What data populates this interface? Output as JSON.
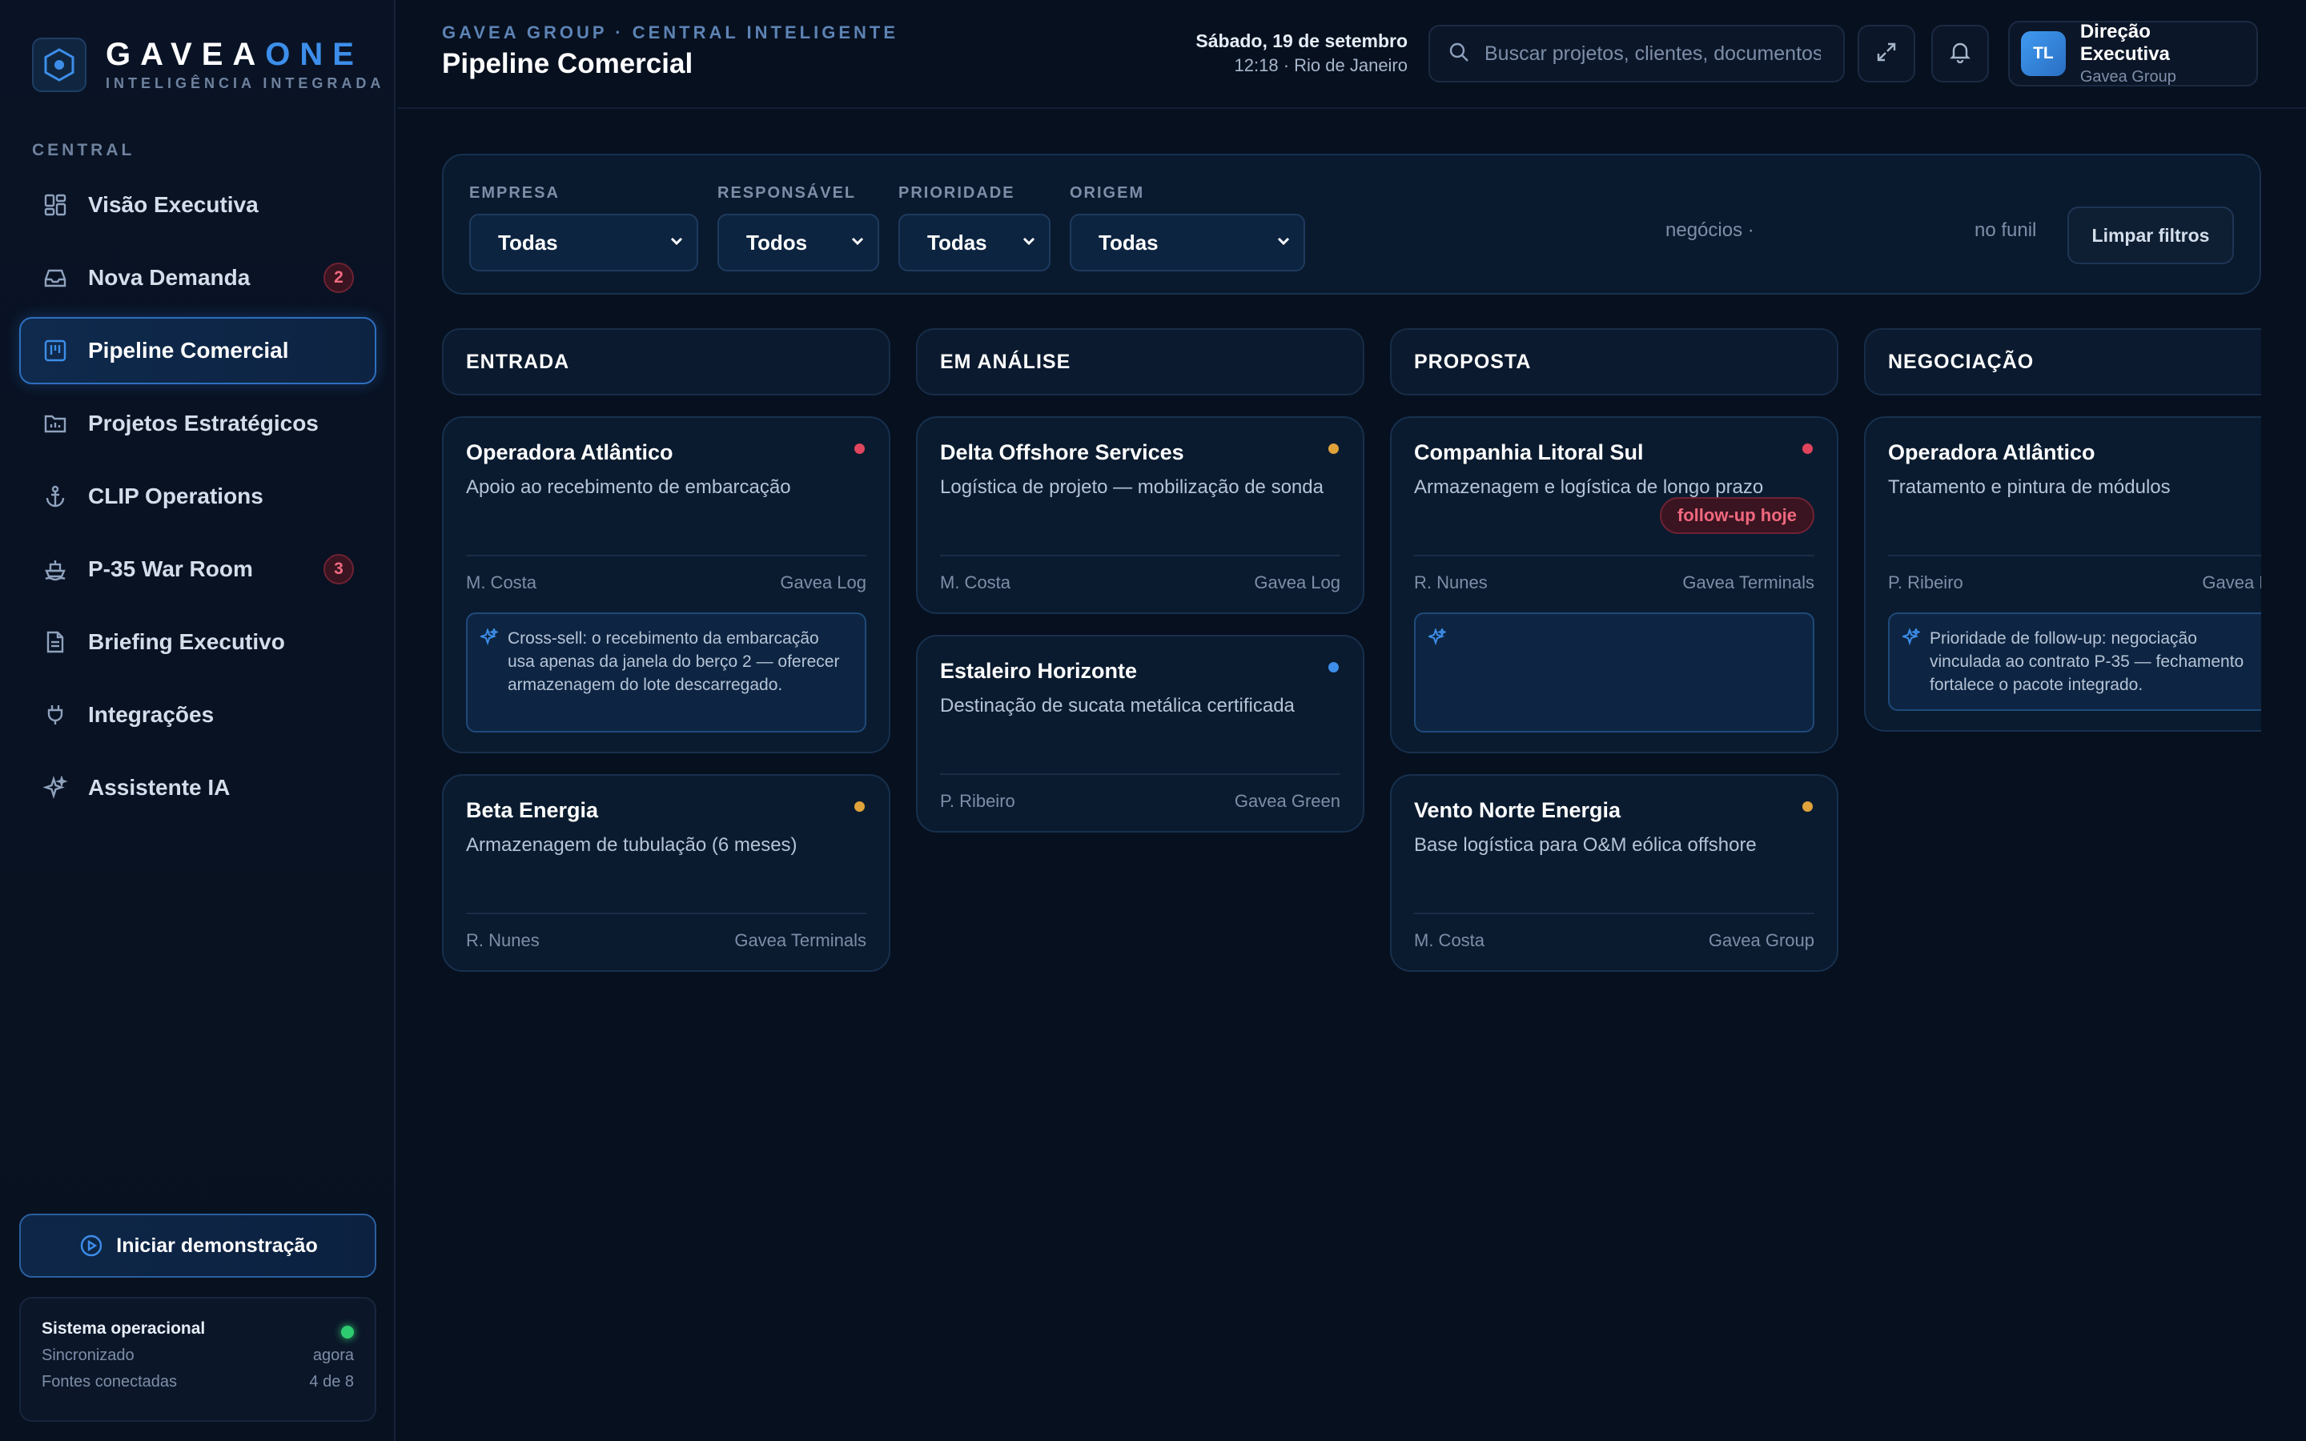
{
  "brand": {
    "name_main": "GAVEA",
    "name_accent": "ONE",
    "subtitle": "INTELIGÊNCIA INTEGRADA"
  },
  "sidebar": {
    "section": "CENTRAL",
    "items": [
      {
        "label": "Visão Executiva",
        "icon": "dashboard-icon"
      },
      {
        "label": "Nova Demanda",
        "icon": "inbox-icon",
        "badge": "2"
      },
      {
        "label": "Pipeline Comercial",
        "icon": "kanban-icon",
        "active": true
      },
      {
        "label": "Projetos Estratégicos",
        "icon": "chart-folder-icon"
      },
      {
        "label": "CLIP Operations",
        "icon": "anchor-icon"
      },
      {
        "label": "P-35 War Room",
        "icon": "ship-icon",
        "badge": "3"
      },
      {
        "label": "Briefing Executivo",
        "icon": "document-icon"
      },
      {
        "label": "Integrações",
        "icon": "plug-icon"
      },
      {
        "label": "Assistente IA",
        "icon": "sparkle-icon"
      }
    ],
    "demo_button": "Iniciar demonstração",
    "status": {
      "title": "Sistema operacional",
      "rows": [
        {
          "label": "Sincronizado",
          "value": "agora"
        },
        {
          "label": "Fontes conectadas",
          "value": "4 de 8"
        }
      ]
    }
  },
  "header": {
    "breadcrumb": "GAVEA GROUP · CENTRAL INTELIGENTE",
    "title": "Pipeline Comercial",
    "date": "Sábado, 19 de setembro",
    "time": "12:18 · Rio de Janeiro",
    "search_placeholder": "Buscar projetos, clientes, documentos",
    "user": {
      "initials": "TL",
      "name": "Direção Executiva",
      "org": "Gavea Group"
    }
  },
  "filters": {
    "items": [
      {
        "label": "EMPRESA",
        "value": "Todas"
      },
      {
        "label": "RESPONSÁVEL",
        "value": "Todos"
      },
      {
        "label": "PRIORIDADE",
        "value": "Todas"
      },
      {
        "label": "ORIGEM",
        "value": "Todas"
      }
    ],
    "count_left": "negócios ·",
    "count_right": "no funil",
    "clear": "Limpar filtros"
  },
  "columns": [
    {
      "title": "ENTRADA"
    },
    {
      "title": "EM ANÁLISE"
    },
    {
      "title": "PROPOSTA"
    },
    {
      "title": "NEGOCIAÇÃO"
    }
  ],
  "cards": {
    "c1": {
      "title": "Operadora Atlântico",
      "desc": "Apoio ao recebimento de embarcação",
      "owner": "M. Costa",
      "company": "Gavea Log",
      "insight": "Cross-sell: o recebimento da embarcação usa apenas da janela do berço 2 — oferecer armazenagem do lote descarregado.",
      "dot": "#e0455e"
    },
    "c2": {
      "title": "Beta Energia",
      "desc": "Armazenagem de tubulação (6 meses)",
      "owner": "R. Nunes",
      "company": "Gavea Terminals",
      "dot": "#e0a23a"
    },
    "c3": {
      "title": "Delta Offshore Services",
      "desc": "Logística de projeto — mobilização de sonda",
      "owner": "M. Costa",
      "company": "Gavea Log",
      "dot": "#e0a23a"
    },
    "c4": {
      "title": "Estaleiro Horizonte",
      "desc": "Destinação de sucata metálica certificada",
      "owner": "P. Ribeiro",
      "company": "Gavea Green",
      "dot": "#3d8eea"
    },
    "c5": {
      "title": "Companhia Litoral Sul",
      "desc": "Armazenagem e logística de longo prazo",
      "tag": "follow-up hoje",
      "owner": "R. Nunes",
      "company": "Gavea Terminals",
      "insight": "",
      "dot": "#e0455e"
    },
    "c6": {
      "title": "Vento Norte Energia",
      "desc": "Base logística para O&M eólica offshore",
      "owner": "M. Costa",
      "company": "Gavea Group",
      "dot": "#e0a23a"
    },
    "c7": {
      "title": "Operadora Atlântico",
      "desc": "Tratamento e pintura de módulos",
      "owner": "P. Ribeiro",
      "company": "Gavea Log",
      "insight": "Prioridade de follow-up: negociação vinculada ao contrato P-35 — fechamento fortalece o pacote integrado."
    }
  }
}
